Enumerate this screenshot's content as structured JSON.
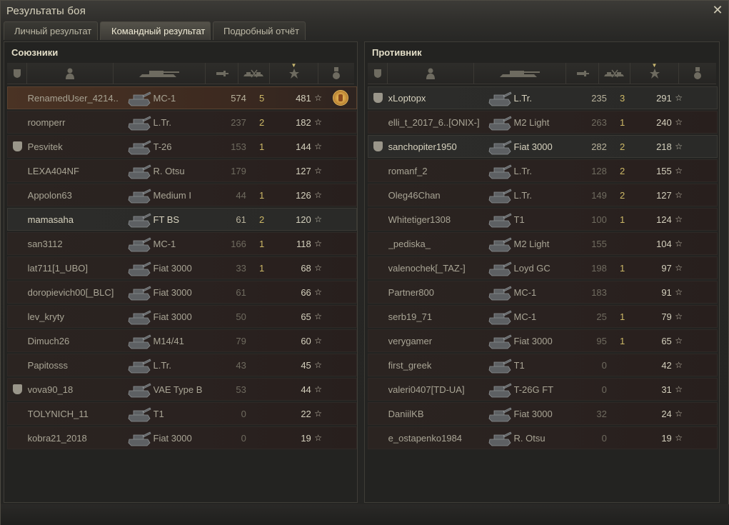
{
  "window": {
    "title": "Результаты боя"
  },
  "tabs": [
    {
      "label": "Личный результат",
      "active": false
    },
    {
      "label": "Командный результат",
      "active": true
    },
    {
      "label": "Подробный отчёт",
      "active": false
    }
  ],
  "teams": {
    "allies": {
      "title": "Союзники",
      "rows": [
        {
          "name": "RenamedUser_4214..",
          "tank": "МС-1",
          "damage": "574",
          "kills": "5",
          "xp": "481",
          "squad": false,
          "medal": true,
          "style": "self"
        },
        {
          "name": "roomperr",
          "tank": "L.Tr.",
          "damage": "237",
          "kills": "2",
          "xp": "182",
          "squad": false,
          "medal": false,
          "style": "dark"
        },
        {
          "name": "Pesvitek",
          "tank": "T-26",
          "damage": "153",
          "kills": "1",
          "xp": "144",
          "squad": true,
          "medal": false,
          "style": "dark"
        },
        {
          "name": "LEXA404NF",
          "tank": "R. Otsu",
          "damage": "179",
          "kills": "",
          "xp": "127",
          "squad": false,
          "medal": false,
          "style": "dark"
        },
        {
          "name": "Appolon63",
          "tank": "Medium I",
          "damage": "44",
          "kills": "1",
          "xp": "126",
          "squad": false,
          "medal": false,
          "style": "dark"
        },
        {
          "name": "mamasaha",
          "tank": "FT BS",
          "damage": "61",
          "kills": "2",
          "xp": "120",
          "squad": false,
          "medal": false,
          "style": "light"
        },
        {
          "name": "san3112",
          "tank": "МС-1",
          "damage": "166",
          "kills": "1",
          "xp": "118",
          "squad": false,
          "medal": false,
          "style": "dark"
        },
        {
          "name": "lat711[1_UBO]",
          "tank": "Fiat 3000",
          "damage": "33",
          "kills": "1",
          "xp": "68",
          "squad": false,
          "medal": false,
          "style": "dark"
        },
        {
          "name": "doropievich00[_BLC]",
          "tank": "Fiat 3000",
          "damage": "61",
          "kills": "",
          "xp": "66",
          "squad": false,
          "medal": false,
          "style": "dark"
        },
        {
          "name": "lev_kryty",
          "tank": "Fiat 3000",
          "damage": "50",
          "kills": "",
          "xp": "65",
          "squad": false,
          "medal": false,
          "style": "dark"
        },
        {
          "name": "Dimuch26",
          "tank": "M14/41",
          "damage": "79",
          "kills": "",
          "xp": "60",
          "squad": false,
          "medal": false,
          "style": "dark"
        },
        {
          "name": "Papitosss",
          "tank": "L.Tr.",
          "damage": "43",
          "kills": "",
          "xp": "45",
          "squad": false,
          "medal": false,
          "style": "dark"
        },
        {
          "name": "vova90_18",
          "tank": "VAE Type B",
          "damage": "53",
          "kills": "",
          "xp": "44",
          "squad": true,
          "medal": false,
          "style": "dark"
        },
        {
          "name": "TOLYNICH_11",
          "tank": "T1",
          "damage": "0",
          "kills": "",
          "xp": "22",
          "squad": false,
          "medal": false,
          "style": "dark"
        },
        {
          "name": "kobra21_2018",
          "tank": "Fiat 3000",
          "damage": "0",
          "kills": "",
          "xp": "19",
          "squad": false,
          "medal": false,
          "style": "dark"
        }
      ]
    },
    "enemies": {
      "title": "Противник",
      "rows": [
        {
          "name": "xLoptopx",
          "tank": "L.Tr.",
          "damage": "235",
          "kills": "3",
          "xp": "291",
          "squad": true,
          "medal": false,
          "style": "light"
        },
        {
          "name": "elli_t_2017_6..[ONIX-]",
          "tank": "M2 Light",
          "damage": "263",
          "kills": "1",
          "xp": "240",
          "squad": false,
          "medal": false,
          "style": "dark"
        },
        {
          "name": "sanchopiter1950",
          "tank": "Fiat 3000",
          "damage": "282",
          "kills": "2",
          "xp": "218",
          "squad": true,
          "medal": false,
          "style": "light"
        },
        {
          "name": "romanf_2",
          "tank": "L.Tr.",
          "damage": "128",
          "kills": "2",
          "xp": "155",
          "squad": false,
          "medal": false,
          "style": "dark"
        },
        {
          "name": "Oleg46Chan",
          "tank": "L.Tr.",
          "damage": "149",
          "kills": "2",
          "xp": "127",
          "squad": false,
          "medal": false,
          "style": "dark"
        },
        {
          "name": "Whitetiger1308",
          "tank": "T1",
          "damage": "100",
          "kills": "1",
          "xp": "124",
          "squad": false,
          "medal": false,
          "style": "dark"
        },
        {
          "name": "_pediska_",
          "tank": "M2 Light",
          "damage": "155",
          "kills": "",
          "xp": "104",
          "squad": false,
          "medal": false,
          "style": "dark"
        },
        {
          "name": "valenochek[_TAZ-]",
          "tank": "Loyd GC",
          "damage": "198",
          "kills": "1",
          "xp": "97",
          "squad": false,
          "medal": false,
          "style": "dark"
        },
        {
          "name": "Partner800",
          "tank": "МС-1",
          "damage": "183",
          "kills": "",
          "xp": "91",
          "squad": false,
          "medal": false,
          "style": "dark"
        },
        {
          "name": "serb19_71",
          "tank": "МС-1",
          "damage": "25",
          "kills": "1",
          "xp": "79",
          "squad": false,
          "medal": false,
          "style": "dark"
        },
        {
          "name": "verygamer",
          "tank": "Fiat 3000",
          "damage": "95",
          "kills": "1",
          "xp": "65",
          "squad": false,
          "medal": false,
          "style": "dark"
        },
        {
          "name": "first_greek",
          "tank": "T1",
          "damage": "0",
          "kills": "",
          "xp": "42",
          "squad": false,
          "medal": false,
          "style": "dark"
        },
        {
          "name": "valeri0407[TD-UA]",
          "tank": "T-26G FT",
          "damage": "0",
          "kills": "",
          "xp": "31",
          "squad": false,
          "medal": false,
          "style": "dark"
        },
        {
          "name": "DaniilKB",
          "tank": "Fiat 3000",
          "damage": "32",
          "kills": "",
          "xp": "24",
          "squad": false,
          "medal": false,
          "style": "dark"
        },
        {
          "name": "e_ostapenko1984",
          "tank": "R. Otsu",
          "damage": "0",
          "kills": "",
          "xp": "19",
          "squad": false,
          "medal": false,
          "style": "dark"
        }
      ]
    }
  },
  "icons": {
    "star": "☆",
    "close": "✕"
  }
}
